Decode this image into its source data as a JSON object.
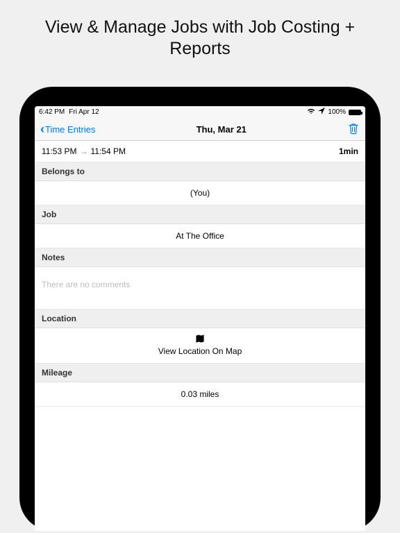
{
  "promo": {
    "title": "View & Manage Jobs with Job Costing + Reports"
  },
  "statusbar": {
    "time": "6:42 PM",
    "date": "Fri Apr 12",
    "battery_pct": "100%"
  },
  "nav": {
    "back_label": "Time Entries",
    "title": "Thu, Mar 21"
  },
  "entry": {
    "start_time": "11:53 PM",
    "end_time": "11:54 PM",
    "duration": "1min"
  },
  "sections": {
    "belongs_to": {
      "header": "Belongs to",
      "value": "(You)"
    },
    "job": {
      "header": "Job",
      "value": "At The Office"
    },
    "notes": {
      "header": "Notes",
      "placeholder": "There are no comments"
    },
    "location": {
      "header": "Location",
      "link_label": "View Location On Map"
    },
    "mileage": {
      "header": "Mileage",
      "value": "0.03 miles"
    }
  },
  "colors": {
    "accent": "#007aff"
  }
}
